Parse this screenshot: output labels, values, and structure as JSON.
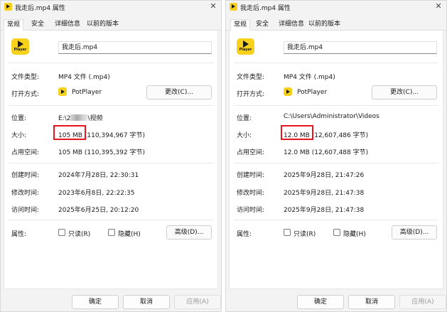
{
  "left_dialog": {
    "title": "我走后.mp4 属性",
    "tabs": [
      "常规",
      "安全",
      "详细信息",
      "以前的版本"
    ],
    "icon_label": "Player",
    "filename": "我走后.mp4",
    "file_type_label": "文件类型:",
    "file_type_value": "MP4 文件 (.mp4)",
    "open_with_label": "打开方式:",
    "open_with_value": "PotPlayer",
    "change_button": "更改(C)...",
    "location_label": "位置:",
    "location_prefix": "E:\\2",
    "location_suffix": "\\视频",
    "size_label": "大小:",
    "size_main": "105 MB",
    "size_detail": "(110,394,967 字节)",
    "disk_size_label": "占用空间:",
    "disk_size_value": "105 MB (110,395,392 字节)",
    "created_label": "创建时间:",
    "created_value": "2024年7月28日, 22:30:31",
    "modified_label": "修改时间:",
    "modified_value": "2023年6月8日, 22:22:35",
    "accessed_label": "访问时间:",
    "accessed_value": "2025年6月25日, 20:12:20",
    "attributes_label": "属性:",
    "readonly_label": "只读(R)",
    "hidden_label": "隐藏(H)",
    "advanced_button": "高级(D)...",
    "ok_button": "确定",
    "cancel_button": "取消",
    "apply_button": "应用(A)"
  },
  "right_dialog": {
    "title": "我走后.mp4 属性",
    "tabs": [
      "常规",
      "安全",
      "详细信息",
      "以前的版本"
    ],
    "icon_label": "Player",
    "filename": "我走后.mp4",
    "file_type_label": "文件类型:",
    "file_type_value": "MP4 文件 (.mp4)",
    "open_with_label": "打开方式:",
    "open_with_value": "PotPlayer",
    "change_button": "更改(C)...",
    "location_label": "位置:",
    "location_value": "C:\\Users\\Administrator\\Videos",
    "size_label": "大小:",
    "size_main": "12.0 MB",
    "size_detail": "(12,607,486 字节)",
    "disk_size_label": "占用空间:",
    "disk_size_value": "12.0 MB (12,607,488 字节)",
    "created_label": "创建时间:",
    "created_value": "2025年9月28日, 21:47:26",
    "modified_label": "修改时间:",
    "modified_value": "2025年9月28日, 21:47:38",
    "accessed_label": "访问时间:",
    "accessed_value": "2025年9月28日, 21:47:38",
    "attributes_label": "属性:",
    "readonly_label": "只读(R)",
    "hidden_label": "隐藏(H)",
    "advanced_button": "高级(D)...",
    "ok_button": "确定",
    "cancel_button": "取消",
    "apply_button": "应用(A)"
  },
  "colors": {
    "highlight_box": "#e8151f",
    "app_icon": "#f7d11b",
    "dialog_bg": "#f3f3f3"
  }
}
